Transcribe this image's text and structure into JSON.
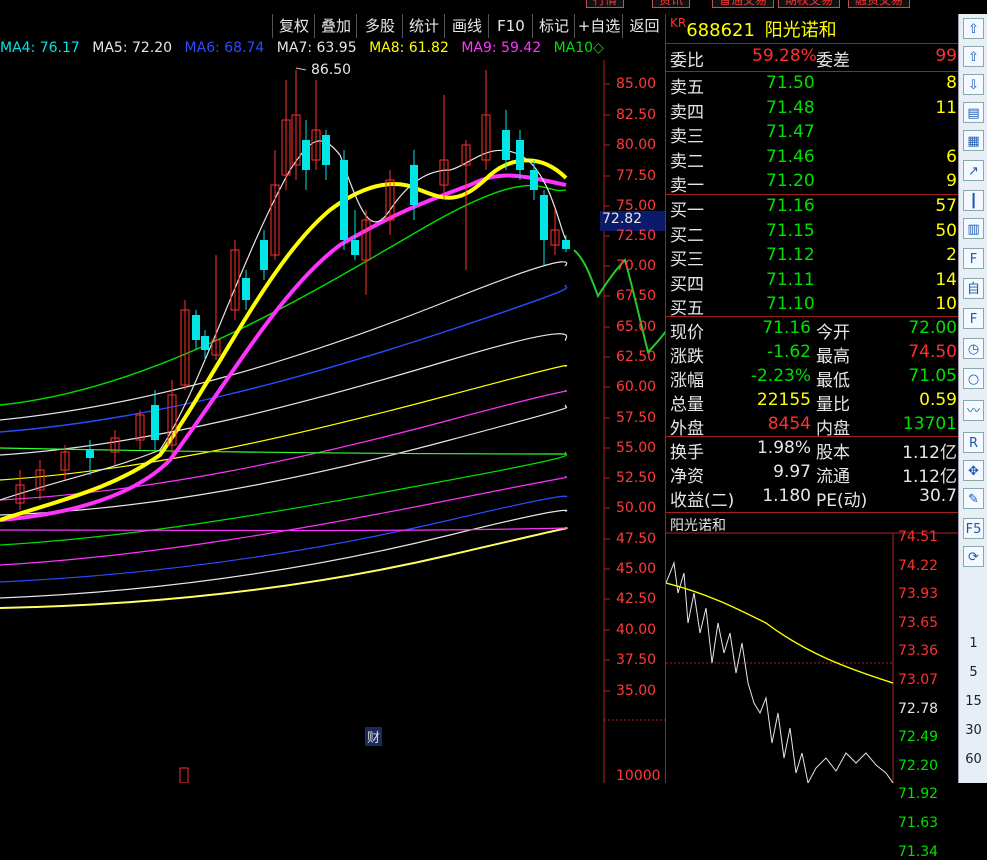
{
  "top_tabs": [
    "行情",
    "资讯",
    "普通交易",
    "期权交易",
    "融资交易"
  ],
  "toolbar": [
    "复权",
    "叠加",
    "多股",
    "统计",
    "画线",
    "F10",
    "标记",
    "+自选",
    "返回"
  ],
  "ma_legend": [
    {
      "label": "MA4: 76.17",
      "color": "#00e5e5"
    },
    {
      "label": "MA5: 72.20",
      "color": "#e6e6e6"
    },
    {
      "label": "MA6: 68.74",
      "color": "#2a4cff"
    },
    {
      "label": "MA7: 63.95",
      "color": "#e6e6e6"
    },
    {
      "label": "MA8: 61.82",
      "color": "#ffff00"
    },
    {
      "label": "MA9: 59.42",
      "color": "#ff33ff"
    },
    {
      "label": "MA10◇",
      "color": "#00e000"
    }
  ],
  "price_axis": [
    "85.00",
    "82.50",
    "80.00",
    "77.50",
    "75.00",
    "72.50",
    "70.00",
    "67.50",
    "65.00",
    "62.50",
    "60.00",
    "57.50",
    "55.00",
    "52.50",
    "50.00",
    "47.50",
    "45.00",
    "42.50",
    "40.00",
    "37.50",
    "35.00"
  ],
  "high_marker": "86.50",
  "current_price_tag": "72.82",
  "finance_marker": "财",
  "volume_label": "10000",
  "stock": {
    "market_tag": "KR",
    "code": "688621",
    "name": "阳光诺和"
  },
  "weibi": {
    "label1": "委比",
    "value1": "59.28%",
    "label2": "委差",
    "value2": "99"
  },
  "asks": [
    {
      "label": "卖五",
      "price": "71.50",
      "qty": "8"
    },
    {
      "label": "卖四",
      "price": "71.48",
      "qty": "11"
    },
    {
      "label": "卖三",
      "price": "71.47",
      "qty": ""
    },
    {
      "label": "卖二",
      "price": "71.46",
      "qty": "6"
    },
    {
      "label": "卖一",
      "price": "71.20",
      "qty": "9"
    }
  ],
  "bids": [
    {
      "label": "买一",
      "price": "71.16",
      "qty": "57"
    },
    {
      "label": "买二",
      "price": "71.15",
      "qty": "50"
    },
    {
      "label": "买三",
      "price": "71.12",
      "qty": "2"
    },
    {
      "label": "买四",
      "price": "71.11",
      "qty": "14"
    },
    {
      "label": "买五",
      "price": "71.10",
      "qty": "10"
    }
  ],
  "quote": [
    {
      "l1": "现价",
      "v1": "71.16",
      "c1": "green",
      "l2": "今开",
      "v2": "72.00",
      "c2": "green"
    },
    {
      "l1": "涨跌",
      "v1": "-1.62",
      "c1": "green",
      "l2": "最高",
      "v2": "74.50",
      "c2": "red"
    },
    {
      "l1": "涨幅",
      "v1": "-2.23%",
      "c1": "green",
      "l2": "最低",
      "v2": "71.05",
      "c2": "green"
    },
    {
      "l1": "总量",
      "v1": "22155",
      "c1": "yellow",
      "l2": "量比",
      "v2": "0.59",
      "c2": "yellow"
    },
    {
      "l1": "外盘",
      "v1": "8454",
      "c1": "red",
      "l2": "内盘",
      "v2": "13701",
      "c2": "green"
    }
  ],
  "fundamentals": [
    {
      "l1": "换手",
      "v1": "1.98%",
      "l2": "股本",
      "v2": "1.12亿"
    },
    {
      "l1": "净资",
      "v1": "9.97",
      "l2": "流通",
      "v2": "1.12亿"
    },
    {
      "l1": "收益(二)",
      "v1": "1.180",
      "l2": "PE(动)",
      "v2": "30.7"
    }
  ],
  "intraday": {
    "title": "阳光诺和",
    "axis": [
      "74.51",
      "74.22",
      "73.93",
      "73.65",
      "73.36",
      "73.07",
      "72.78",
      "72.49",
      "72.20",
      "71.92",
      "71.63",
      "71.34"
    ]
  },
  "sidebar_icons": [
    "up-arrow-icon",
    "up-outline-icon",
    "down-outline-icon",
    "report-icon",
    "grid-icon",
    "trend-icon",
    "kline-icon",
    "bar-icon",
    "f10-icon",
    "zi-icon",
    "fz-icon",
    "clock-icon",
    "circle-icon",
    "wave-icon",
    "rsi-icon",
    "move-icon",
    "pen-icon",
    "f5-icon",
    "refresh-icon"
  ],
  "sidebar_labels": [
    "RSI",
    "F5"
  ],
  "sidebar_periods": [
    "1",
    "5",
    "15",
    "30",
    "60"
  ]
}
